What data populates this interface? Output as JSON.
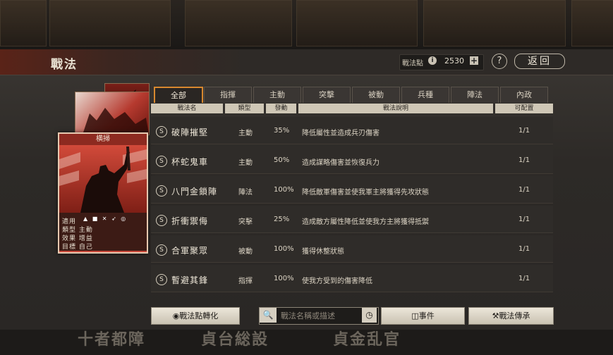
{
  "header": {
    "title": "戰法",
    "points_label": "戰法點",
    "points_value": "2530",
    "help": "?",
    "back": "返回"
  },
  "card": {
    "name": "横掃",
    "stats": [
      {
        "label": "適用",
        "value": ""
      },
      {
        "label": "類型",
        "value": "主動"
      },
      {
        "label": "效果",
        "value": "增益"
      },
      {
        "label": "目標",
        "value": "自己"
      }
    ]
  },
  "tabs": [
    "全部",
    "指揮",
    "主動",
    "突擊",
    "被動",
    "兵種",
    "陣法",
    "內政"
  ],
  "table": {
    "headers": [
      "戰法名",
      "類型",
      "發動",
      "戰法說明",
      "可配置"
    ],
    "rows": [
      {
        "grade": "S",
        "name": "破陣摧堅",
        "type": "主動",
        "cost": "35%",
        "desc": "降低屬性並造成兵刃傷害",
        "avail": "1/1"
      },
      {
        "grade": "S",
        "name": "杯蛇鬼車",
        "type": "主動",
        "cost": "50%",
        "desc": "造成謀略傷害並恢復兵力",
        "avail": "1/1"
      },
      {
        "grade": "S",
        "name": "八門金鎖陣",
        "type": "陣法",
        "cost": "100%",
        "desc": "降低敵軍傷害並使我軍主將獲得先攻狀態",
        "avail": "1/1"
      },
      {
        "grade": "S",
        "name": "折衝禦侮",
        "type": "突擊",
        "cost": "25%",
        "desc": "造成敵方屬性降低並使我方主將獲得抵禦",
        "avail": "1/1"
      },
      {
        "grade": "S",
        "name": "合軍聚眾",
        "type": "被動",
        "cost": "100%",
        "desc": "獲得休整狀態",
        "avail": "1/1"
      },
      {
        "grade": "S",
        "name": "暫避其鋒",
        "type": "指揮",
        "cost": "100%",
        "desc": "使我方受到的傷害降低",
        "avail": "1/1"
      }
    ]
  },
  "footer": {
    "convert": "戰法點轉化",
    "search_placeholder": "戰法名稱或描述",
    "events": "事件",
    "inherit": "戰法傳承"
  },
  "background": {
    "bottom_items": [
      "十者都障",
      "貞台総設",
      "貞金乱官"
    ]
  },
  "colors": {
    "accent_tab": "#d8882f",
    "card_red": "#c9493a"
  }
}
